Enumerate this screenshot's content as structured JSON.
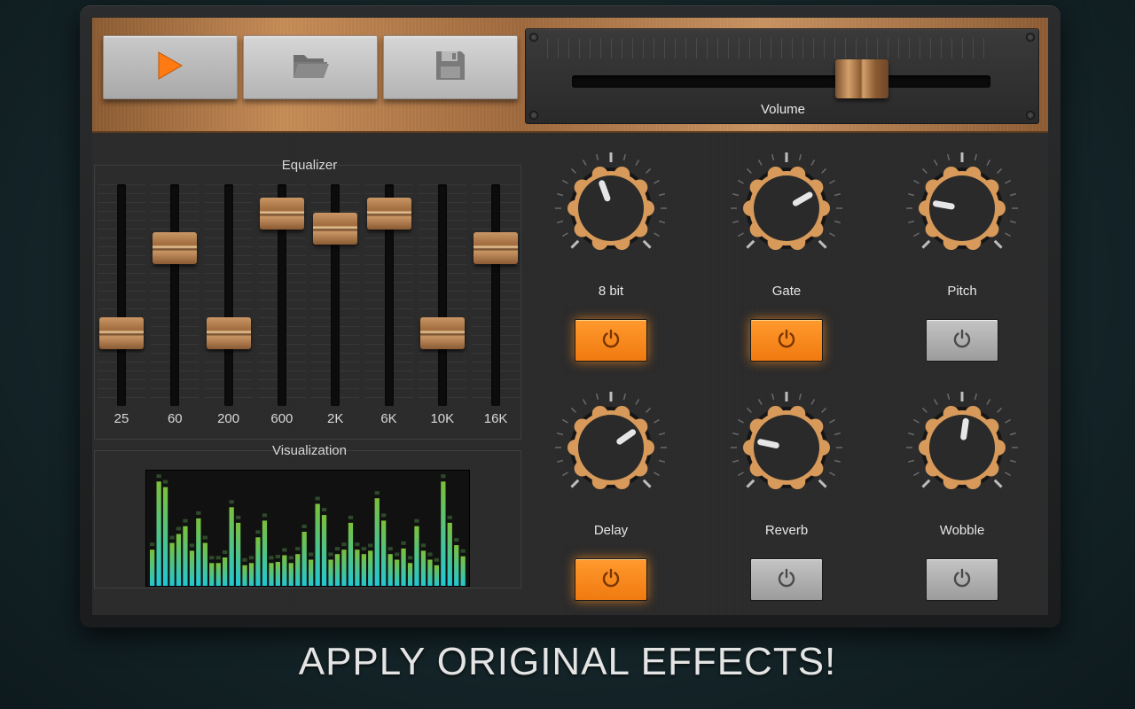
{
  "toolbar": {
    "play_icon": "play-icon",
    "open_icon": "folder-open-icon",
    "save_icon": "floppy-disk-icon"
  },
  "volume": {
    "label": "Volume",
    "level": 0.72
  },
  "equalizer": {
    "title": "Equalizer",
    "bands": [
      {
        "label": "25",
        "level": 0.3
      },
      {
        "label": "60",
        "level": 0.75
      },
      {
        "label": "200",
        "level": 0.3
      },
      {
        "label": "600",
        "level": 0.93
      },
      {
        "label": "2K",
        "level": 0.85
      },
      {
        "label": "6K",
        "level": 0.93
      },
      {
        "label": "10K",
        "level": 0.3
      },
      {
        "label": "16K",
        "level": 0.75
      }
    ]
  },
  "visualization": {
    "title": "Visualization",
    "levels": [
      0.34,
      0.95,
      0.9,
      0.4,
      0.48,
      0.55,
      0.33,
      0.62,
      0.4,
      0.22,
      0.22,
      0.27,
      0.72,
      0.58,
      0.2,
      0.22,
      0.45,
      0.6,
      0.22,
      0.23,
      0.29,
      0.22,
      0.3,
      0.5,
      0.25,
      0.75,
      0.65,
      0.25,
      0.3,
      0.34,
      0.58,
      0.34,
      0.3,
      0.33,
      0.8,
      0.6,
      0.3,
      0.25,
      0.35,
      0.22,
      0.55,
      0.33,
      0.25,
      0.2,
      0.95,
      0.58,
      0.38,
      0.28
    ]
  },
  "effects": [
    {
      "label": "8 bit",
      "angle": -20,
      "on": true
    },
    {
      "label": "Gate",
      "angle": 60,
      "on": true
    },
    {
      "label": "Pitch",
      "angle": -80,
      "on": false
    },
    {
      "label": "Delay",
      "angle": 55,
      "on": true
    },
    {
      "label": "Reverb",
      "angle": -78,
      "on": false
    },
    {
      "label": "Wobble",
      "angle": 8,
      "on": false
    }
  ],
  "colors": {
    "accent_on": "#f58a1a",
    "copper": "#c48a55",
    "viz_top": "#7bc03a",
    "viz_bottom": "#1ec8d8"
  },
  "caption": "APPLY ORIGINAL EFFECTS!"
}
